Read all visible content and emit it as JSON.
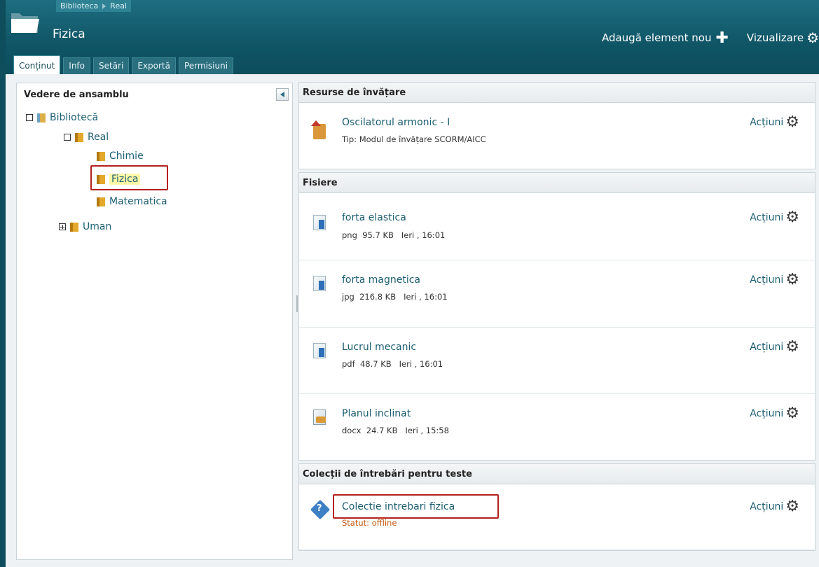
{
  "breadcrumb": [
    "Biblioteca",
    "Real"
  ],
  "page_title": "Fizica",
  "header_actions": {
    "add_label": "Adaugă element nou",
    "view_label": "Vizualizare"
  },
  "tabs": [
    {
      "label": "Conținut",
      "active": true
    },
    {
      "label": "Info",
      "active": false
    },
    {
      "label": "Setări",
      "active": false
    },
    {
      "label": "Exportă",
      "active": false
    },
    {
      "label": "Permisiuni",
      "active": false
    }
  ],
  "overview": {
    "title": "Vedere de ansamblu",
    "tree": {
      "biblioteca": "Bibliotecă",
      "real": "Real",
      "chimie": "Chimie",
      "fizica": "Fizica",
      "matematica": "Matematica",
      "uman": "Uman"
    }
  },
  "sections": [
    {
      "title": "Resurse de învățare",
      "items": [
        {
          "title": "Oscilatorul armonic - I",
          "meta": "Tip: Modul de învățare SCORM/AICC",
          "icon": "scorm-package-icon",
          "action": "Acțiuni"
        }
      ]
    },
    {
      "title": "Fisiere",
      "items": [
        {
          "title": "forta elastica",
          "meta": "png  95.7 KB   Ieri , 16:01",
          "icon": "file-icon",
          "action": "Acțiuni"
        },
        {
          "title": "forta magnetica",
          "meta": "jpg  216.8 KB   Ieri , 16:01",
          "icon": "file-icon",
          "action": "Acțiuni"
        },
        {
          "title": "Lucrul mecanic",
          "meta": "pdf  48.7 KB   Ieri , 16:01",
          "icon": "file-icon",
          "action": "Acțiuni"
        },
        {
          "title": "Planul inclinat",
          "meta": "docx  24.7 KB   Ieri , 15:58",
          "icon": "docx-file-icon",
          "action": "Acțiuni"
        }
      ]
    },
    {
      "title": "Colecții de întrebări pentru teste",
      "items": [
        {
          "title": "Colectie intrebari fizica",
          "meta": "Statut: offline",
          "icon": "question-collection-icon",
          "action": "Acțiuni"
        }
      ]
    }
  ],
  "colors": {
    "header_bg": "#0f5566",
    "link": "#1b5d70",
    "highlight_border": "#b3211e",
    "offline_status": "#c2560c"
  }
}
